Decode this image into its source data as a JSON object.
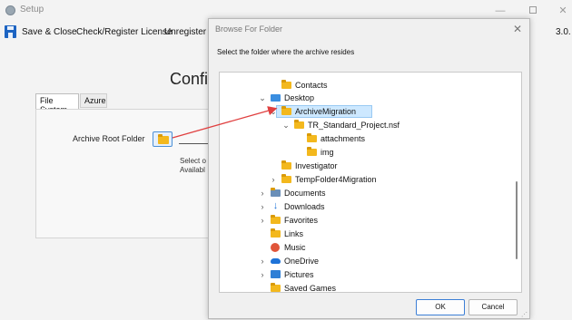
{
  "setup": {
    "title": "Setup",
    "menu": {
      "save_close": "Save & Close",
      "check_register": "Check/Register License",
      "unregister": "Unregister L"
    },
    "version": "3.0.",
    "config_title": "Confi",
    "tabs": [
      {
        "label": "File System"
      },
      {
        "label": "Azure"
      }
    ],
    "archive_root_label": "Archive Root Folder",
    "select_hint_line1": "Select o",
    "select_hint_line2": "Availabl"
  },
  "dialog": {
    "title": "Browse For Folder",
    "instruction": "Select the folder where the archive resides",
    "tree": [
      {
        "label": "Contacts",
        "icon": "folder-icon",
        "chevron": ""
      },
      {
        "label": "Desktop",
        "icon": "desktop-icon",
        "chevron": "v"
      },
      {
        "label": "ArchiveMigration",
        "icon": "folder-icon",
        "chevron": "v",
        "selected": true
      },
      {
        "label": "TR_Standard_Project.nsf",
        "icon": "folder-icon",
        "chevron": "v"
      },
      {
        "label": "attachments",
        "icon": "folder-icon",
        "chevron": ""
      },
      {
        "label": "img",
        "icon": "folder-icon",
        "chevron": ""
      },
      {
        "label": "Investigator",
        "icon": "folder-icon",
        "chevron": ""
      },
      {
        "label": "TempFolder4Migration",
        "icon": "folder-icon",
        "chevron": ">"
      },
      {
        "label": "Documents",
        "icon": "documents-icon",
        "chevron": ">"
      },
      {
        "label": "Downloads",
        "icon": "download-icon",
        "chevron": ">"
      },
      {
        "label": "Favorites",
        "icon": "folder-icon",
        "chevron": ">"
      },
      {
        "label": "Links",
        "icon": "folder-icon",
        "chevron": ""
      },
      {
        "label": "Music",
        "icon": "music-icon",
        "chevron": ""
      },
      {
        "label": "OneDrive",
        "icon": "onedrive-icon",
        "chevron": ">"
      },
      {
        "label": "Pictures",
        "icon": "pictures-icon",
        "chevron": ">"
      },
      {
        "label": "Saved Games",
        "icon": "folder-icon",
        "chevron": ""
      }
    ],
    "ok_label": "OK",
    "cancel_label": "Cancel"
  },
  "colors": {
    "accent": "#1d64c2",
    "selection": "#cde8ff",
    "arrow": "#e04040"
  }
}
